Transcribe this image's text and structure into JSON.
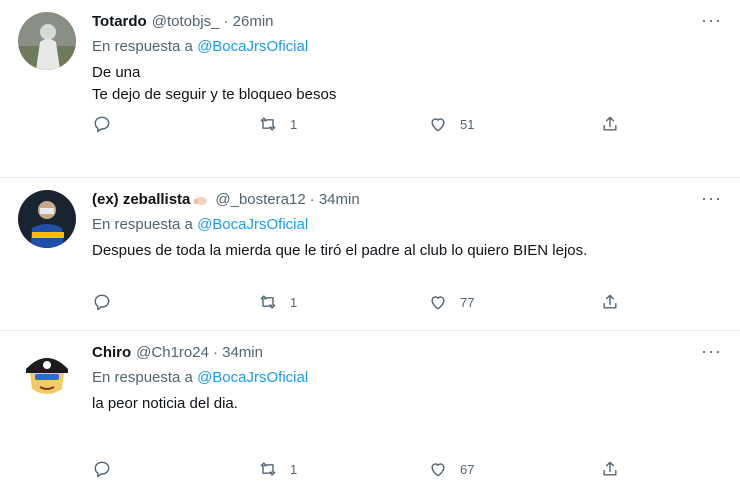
{
  "colors": {
    "link": "#1d9bf0",
    "muted": "#536471",
    "text": "#0f1419"
  },
  "tweets": [
    {
      "name": "Totardo",
      "handle": "@totobjs_",
      "time": "· 26min",
      "replying_label": "En respuesta a",
      "replying_to": "@BocaJrsOficial",
      "text": "De una\nTe dejo de seguir y te bloqueo besos",
      "retweets": "1",
      "likes": "51"
    },
    {
      "name": "(ex) zeballista",
      "handle": "@_bostera12",
      "time": "· 34min",
      "replying_label": "En respuesta a",
      "replying_to": "@BocaJrsOficial",
      "text": "Despues de toda la mierda que le tiró el padre al club lo quiero BIEN lejos.",
      "retweets": "1",
      "likes": "77"
    },
    {
      "name": "Chiro",
      "handle": "@Ch1ro24",
      "time": "· 34min",
      "replying_label": "En respuesta a",
      "replying_to": "@BocaJrsOficial",
      "text": "la peor noticia del dia.",
      "retweets": "1",
      "likes": "67"
    }
  ]
}
